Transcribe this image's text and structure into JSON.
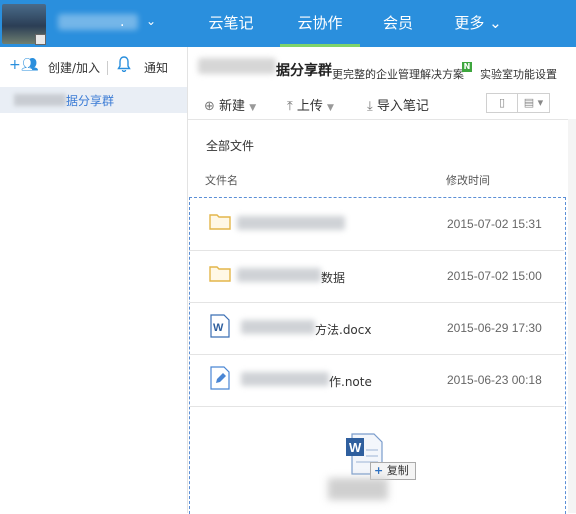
{
  "topbar": {
    "tabs": [
      {
        "label": "云笔记"
      },
      {
        "label": "云协作"
      },
      {
        "label": "会员"
      },
      {
        "label": "更多 ⌄"
      }
    ],
    "name_suffix": "."
  },
  "sidebar": {
    "create_label": "创建/加入",
    "notify_label": "通知",
    "group_label": "据分享群"
  },
  "main": {
    "title": "据分享群",
    "promo": "更完整的企业管理解决方案",
    "lab_label": "实验室功能设置",
    "toolbar": {
      "new_label": "新建",
      "upload_label": "上传",
      "import_label": "导入笔记"
    },
    "breadcrumb": "全部文件",
    "columns": {
      "name": "文件名",
      "modified": "修改时间"
    },
    "files": [
      {
        "name_suffix": "",
        "date": "2015-07-02 15:31",
        "icon": "folder-icon"
      },
      {
        "name_suffix": "数据",
        "date": "2015-07-02 15:00",
        "icon": "folder-icon"
      },
      {
        "name_suffix": "方法.docx",
        "date": "2015-06-29 17:30",
        "icon": "word-doc-icon"
      },
      {
        "name_suffix": "作.note",
        "date": "2015-06-23 00:18",
        "icon": "note-icon"
      }
    ],
    "drag": {
      "copy_label": "复制"
    }
  },
  "colors": {
    "accent": "#2a8fdd",
    "active_underline": "#7fd36a",
    "folder": "#e3b64a"
  }
}
